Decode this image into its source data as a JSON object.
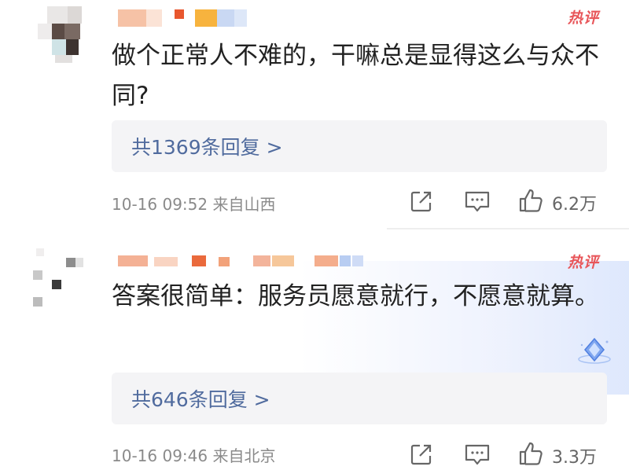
{
  "comments": [
    {
      "text": "做个正常人不难的，干嘛总是显得这么与众不同?",
      "hot_label": "热评",
      "reply_label": "共1369条回复 >",
      "meta": "10-16 09:52 来自山西",
      "likes": "6.2万"
    },
    {
      "text": "答案很简单：服务员愿意就行，不愿意就算。",
      "hot_label": "热评",
      "reply_label": "共646条回复 >",
      "meta": "10-16 09:46 来自北京",
      "likes": "3.3万"
    }
  ],
  "icons": {
    "share": "share-icon",
    "comment": "comment-icon",
    "like": "thumbs-up-icon",
    "badge": "diamond-badge-icon"
  },
  "colors": {
    "hot": "#e8565a",
    "reply_link": "#506b9e",
    "reply_bg": "#f4f4f6",
    "meta": "#8a8a8a"
  }
}
